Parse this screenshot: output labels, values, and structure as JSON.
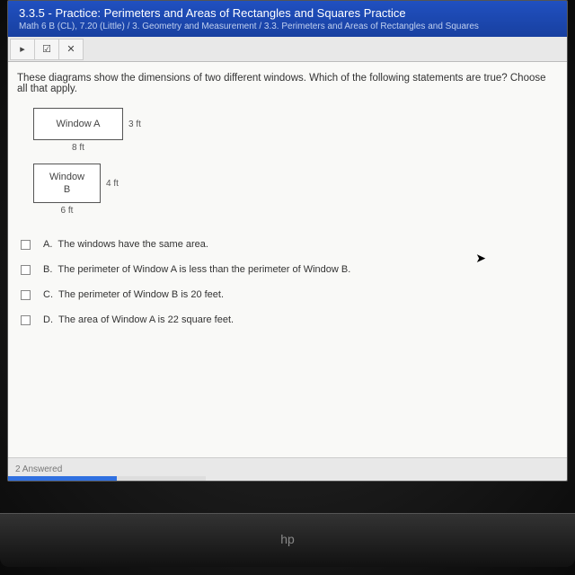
{
  "header": {
    "title": "3.3.5 - Practice: Perimeters and Areas of Rectangles and Squares Practice",
    "breadcrumb": "Math 6 B (CL), 7.20 (Little) / 3. Geometry and Measurement / 3.3. Perimeters and Areas of Rectangles and Squares"
  },
  "toolbar": {
    "btn1": "▸",
    "btn2": "☑",
    "btn3": "✕"
  },
  "question": "These diagrams show the dimensions of two different windows. Which of the following statements are true? Choose all that apply.",
  "windowA": {
    "label": "Window A",
    "width": "8 ft",
    "height": "3 ft"
  },
  "windowB": {
    "labelTop": "Window",
    "labelBottom": "B",
    "width": "6 ft",
    "height": "4 ft"
  },
  "options": {
    "a": {
      "letter": "A.",
      "text": "The windows have the same area."
    },
    "b": {
      "letter": "B.",
      "text": "The perimeter of Window A is less than the perimeter of Window B."
    },
    "c": {
      "letter": "C.",
      "text": "The perimeter of Window B is 20 feet."
    },
    "d": {
      "letter": "D.",
      "text": "The area of Window A is 22 square feet."
    }
  },
  "footer": {
    "status": "2 Answered"
  },
  "logo": "hp"
}
